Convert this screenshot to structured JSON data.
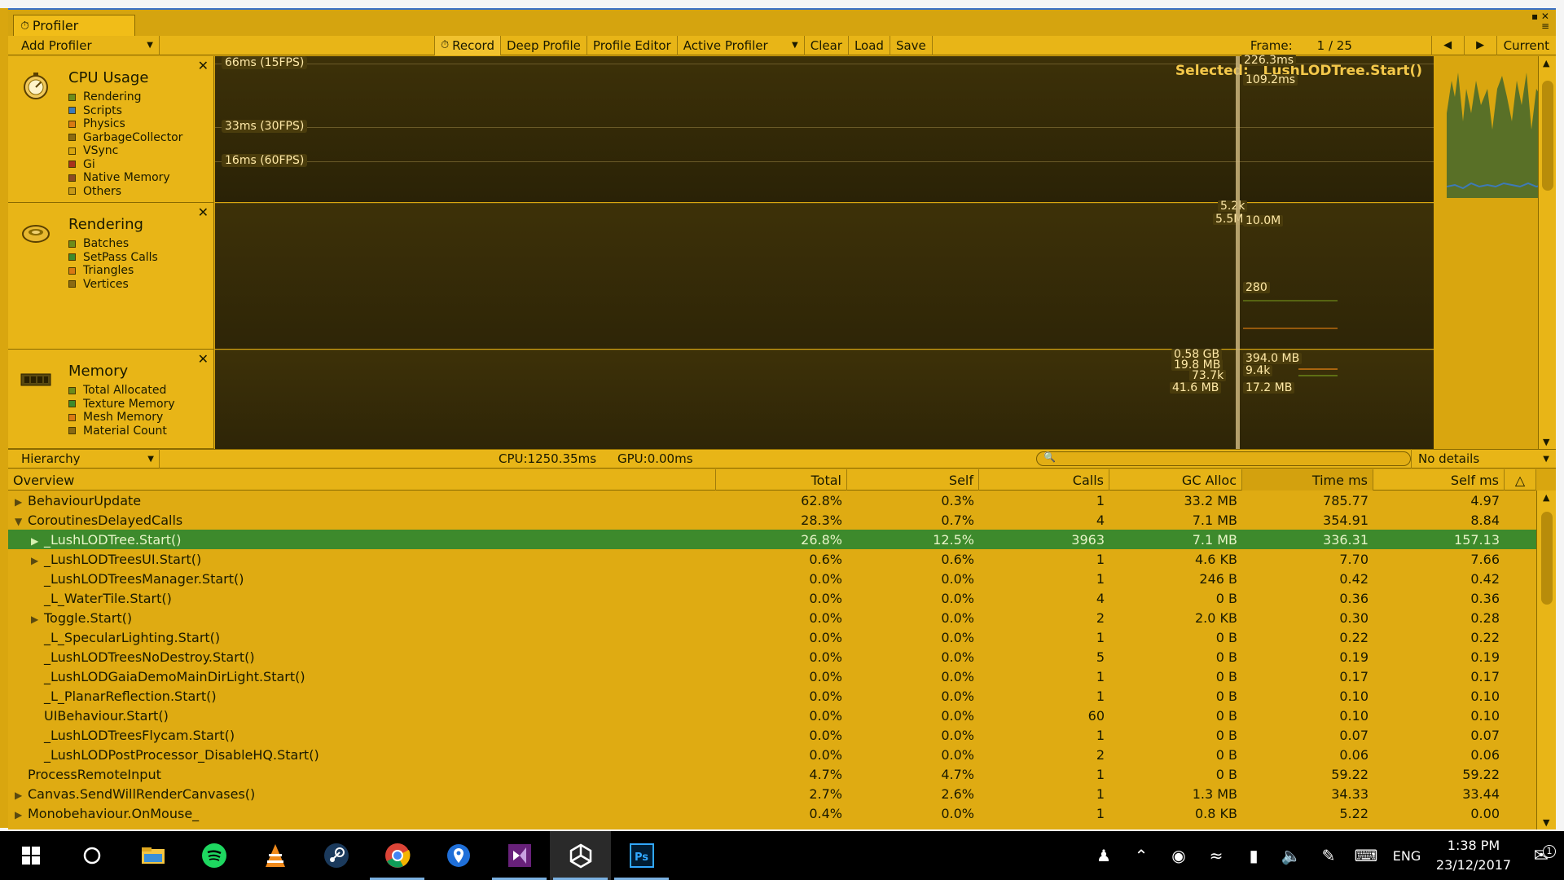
{
  "window": {
    "tab_title": "Profiler",
    "tab_icon": "profiler-icon"
  },
  "toolbar": {
    "add_profiler": "Add Profiler",
    "record": "Record",
    "deep_profile": "Deep Profile",
    "profile_editor": "Profile Editor",
    "active_profiler": "Active Profiler",
    "clear": "Clear",
    "load": "Load",
    "save": "Save",
    "frame_label": "Frame:",
    "frame_value": "1 / 25",
    "current": "Current"
  },
  "modules": {
    "cpu": {
      "title": "CPU Usage",
      "items": [
        {
          "label": "Rendering",
          "color": "#6e8c1a"
        },
        {
          "label": "Scripts",
          "color": "#3d7ab8"
        },
        {
          "label": "Physics",
          "color": "#d97a13"
        },
        {
          "label": "GarbageCollector",
          "color": "#8a6a12"
        },
        {
          "label": "VSync",
          "color": "#d9a60f"
        },
        {
          "label": "Gi",
          "color": "#a8321c"
        },
        {
          "label": "Native Memory",
          "color": "#8a4a24"
        },
        {
          "label": "Others",
          "color": "#c89a18"
        }
      ],
      "graph_lines": [
        {
          "label": "66ms (15FPS)"
        },
        {
          "label": "33ms (30FPS)"
        },
        {
          "label": "16ms (60FPS)"
        }
      ],
      "value_top": "226.3ms",
      "value_selected": "109.2ms",
      "selected_label": "Selected:",
      "selected_value": "LushLODTree.Start()"
    },
    "rendering": {
      "title": "Rendering",
      "items": [
        {
          "label": "Batches",
          "color": "#6e8c1a"
        },
        {
          "label": "SetPass Calls",
          "color": "#3d8a2c"
        },
        {
          "label": "Triangles",
          "color": "#d97a13"
        },
        {
          "label": "Vertices",
          "color": "#8a6a12"
        }
      ],
      "values_left": [
        "5.2k",
        "5.5M"
      ],
      "values_right": [
        "10.0M",
        "280"
      ]
    },
    "memory": {
      "title": "Memory",
      "items": [
        {
          "label": "Total Allocated",
          "color": "#6e8c1a"
        },
        {
          "label": "Texture Memory",
          "color": "#3d8a2c"
        },
        {
          "label": "Mesh Memory",
          "color": "#d97a13"
        },
        {
          "label": "Material Count",
          "color": "#8a6a12"
        }
      ],
      "values_left": [
        "0.58 GB",
        "19.8 MB",
        "73.7k",
        "41.6 MB"
      ],
      "values_right": [
        "394.0 MB",
        "9.4k",
        "17.2 MB"
      ]
    }
  },
  "hierarchy_bar": {
    "view_mode": "Hierarchy",
    "cpu": "CPU:1250.35ms",
    "gpu": "GPU:0.00ms",
    "search_placeholder": "",
    "details": "No details"
  },
  "table": {
    "columns": [
      "Overview",
      "Total",
      "Self",
      "Calls",
      "GC Alloc",
      "Time ms",
      "Self ms"
    ],
    "rows": [
      {
        "name": "BehaviourUpdate",
        "indent": 0,
        "arrow": "right",
        "total": "62.8%",
        "self": "0.3%",
        "calls": "1",
        "gc": "33.2 MB",
        "time": "785.77",
        "selfms": "4.97"
      },
      {
        "name": "CoroutinesDelayedCalls",
        "indent": 0,
        "arrow": "down",
        "total": "28.3%",
        "self": "0.7%",
        "calls": "4",
        "gc": "7.1 MB",
        "time": "354.91",
        "selfms": "8.84"
      },
      {
        "name": "_LushLODTree.Start()",
        "indent": 1,
        "arrow": "right",
        "total": "26.8%",
        "self": "12.5%",
        "calls": "3963",
        "gc": "7.1 MB",
        "time": "336.31",
        "selfms": "157.13",
        "selected": true
      },
      {
        "name": "_LushLODTreesUI.Start()",
        "indent": 1,
        "arrow": "right",
        "total": "0.6%",
        "self": "0.6%",
        "calls": "1",
        "gc": "4.6 KB",
        "time": "7.70",
        "selfms": "7.66"
      },
      {
        "name": "_LushLODTreesManager.Start()",
        "indent": 1,
        "arrow": "",
        "total": "0.0%",
        "self": "0.0%",
        "calls": "1",
        "gc": "246 B",
        "time": "0.42",
        "selfms": "0.42"
      },
      {
        "name": "_L_WaterTile.Start()",
        "indent": 1,
        "arrow": "",
        "total": "0.0%",
        "self": "0.0%",
        "calls": "4",
        "gc": "0 B",
        "time": "0.36",
        "selfms": "0.36"
      },
      {
        "name": "Toggle.Start()",
        "indent": 1,
        "arrow": "right",
        "total": "0.0%",
        "self": "0.0%",
        "calls": "2",
        "gc": "2.0 KB",
        "time": "0.30",
        "selfms": "0.28"
      },
      {
        "name": "_L_SpecularLighting.Start()",
        "indent": 1,
        "arrow": "",
        "total": "0.0%",
        "self": "0.0%",
        "calls": "1",
        "gc": "0 B",
        "time": "0.22",
        "selfms": "0.22"
      },
      {
        "name": "_LushLODTreesNoDestroy.Start()",
        "indent": 1,
        "arrow": "",
        "total": "0.0%",
        "self": "0.0%",
        "calls": "5",
        "gc": "0 B",
        "time": "0.19",
        "selfms": "0.19"
      },
      {
        "name": "_LushLODGaiaDemoMainDirLight.Start()",
        "indent": 1,
        "arrow": "",
        "total": "0.0%",
        "self": "0.0%",
        "calls": "1",
        "gc": "0 B",
        "time": "0.17",
        "selfms": "0.17"
      },
      {
        "name": "_L_PlanarReflection.Start()",
        "indent": 1,
        "arrow": "",
        "total": "0.0%",
        "self": "0.0%",
        "calls": "1",
        "gc": "0 B",
        "time": "0.10",
        "selfms": "0.10"
      },
      {
        "name": "UIBehaviour.Start()",
        "indent": 1,
        "arrow": "",
        "total": "0.0%",
        "self": "0.0%",
        "calls": "60",
        "gc": "0 B",
        "time": "0.10",
        "selfms": "0.10"
      },
      {
        "name": "_LushLODTreesFlycam.Start()",
        "indent": 1,
        "arrow": "",
        "total": "0.0%",
        "self": "0.0%",
        "calls": "1",
        "gc": "0 B",
        "time": "0.07",
        "selfms": "0.07"
      },
      {
        "name": "_LushLODPostProcessor_DisableHQ.Start()",
        "indent": 1,
        "arrow": "",
        "total": "0.0%",
        "self": "0.0%",
        "calls": "2",
        "gc": "0 B",
        "time": "0.06",
        "selfms": "0.06"
      },
      {
        "name": "ProcessRemoteInput",
        "indent": 0,
        "arrow": "",
        "total": "4.7%",
        "self": "4.7%",
        "calls": "1",
        "gc": "0 B",
        "time": "59.22",
        "selfms": "59.22"
      },
      {
        "name": "Canvas.SendWillRenderCanvases()",
        "indent": 0,
        "arrow": "right",
        "total": "2.7%",
        "self": "2.6%",
        "calls": "1",
        "gc": "1.3 MB",
        "time": "34.33",
        "selfms": "33.44"
      },
      {
        "name": "Monobehaviour.OnMouse_",
        "indent": 0,
        "arrow": "right",
        "total": "0.4%",
        "self": "0.0%",
        "calls": "1",
        "gc": "0.8 KB",
        "time": "5.22",
        "selfms": "0.00"
      }
    ]
  },
  "taskbar": {
    "apps": [
      {
        "name": "windows-start-icon"
      },
      {
        "name": "cortana-icon"
      },
      {
        "name": "file-explorer-icon"
      },
      {
        "name": "spotify-icon"
      },
      {
        "name": "vlc-icon"
      },
      {
        "name": "steam-icon"
      },
      {
        "name": "chrome-icon"
      },
      {
        "name": "maps-icon"
      },
      {
        "name": "visual-studio-icon"
      },
      {
        "name": "unity-icon"
      },
      {
        "name": "photoshop-icon"
      }
    ],
    "lang": "ENG",
    "time": "1:38 PM",
    "date": "23/12/2017",
    "notifications": "1"
  }
}
